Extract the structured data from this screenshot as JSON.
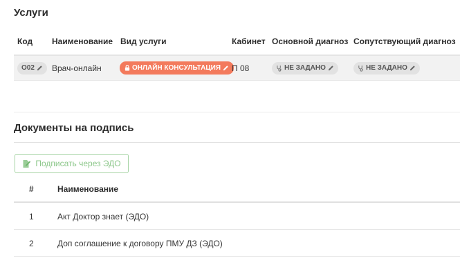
{
  "services": {
    "title": "Услуги",
    "columns": [
      "Код",
      "Наименование",
      "Вид услуги",
      "Кабинет",
      "Основной диагноз",
      "Сопутствующий диагноз"
    ],
    "rows": [
      {
        "code": "О02",
        "name": "Врач-онлайн",
        "service_type": "ОНЛАЙН КОНСУЛЬТАЦИЯ",
        "cabinet": "П 08",
        "main_diagnosis": "НЕ ЗАДАНО",
        "secondary_diagnosis": "НЕ ЗАДАНО"
      }
    ]
  },
  "documents": {
    "title": "Документы на подпись",
    "sign_button": "Подписать через ЭДО",
    "columns": [
      "#",
      "Наименование"
    ],
    "rows": [
      {
        "num": "1",
        "name": "Акт Доктор знает (ЭДО)"
      },
      {
        "num": "2",
        "name": "Доп соглашение к договору ПМУ ДЗ (ЭДО)"
      }
    ]
  },
  "colors": {
    "accent_orange": "#f37a5c",
    "sign_green": "#8cc78a",
    "pill_grey": "#e2e2e2"
  },
  "icons": [
    "pencil-icon",
    "lock-icon",
    "stethoscope-icon",
    "document-sign-icon"
  ]
}
